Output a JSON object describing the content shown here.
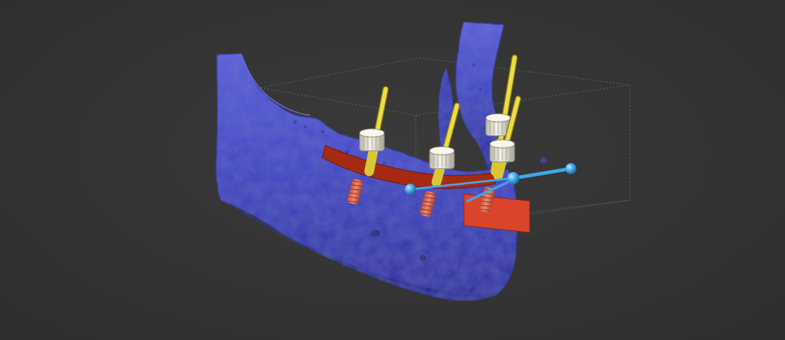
{
  "viewport": {
    "background": "#353535",
    "bone_color": "#3d3fbf",
    "bone_highlight": "#6a6fe0",
    "bone_shadow": "#1e1f80",
    "guide_color": "#b02a10",
    "implant_color": "#e06a50",
    "sleeve_color": "#e8e6d8",
    "pin_color": "#e5d23a",
    "nerve_marker_color": "#3fa8e8",
    "bounding_box_color": "#4e8a4e",
    "implant_count": 4
  }
}
